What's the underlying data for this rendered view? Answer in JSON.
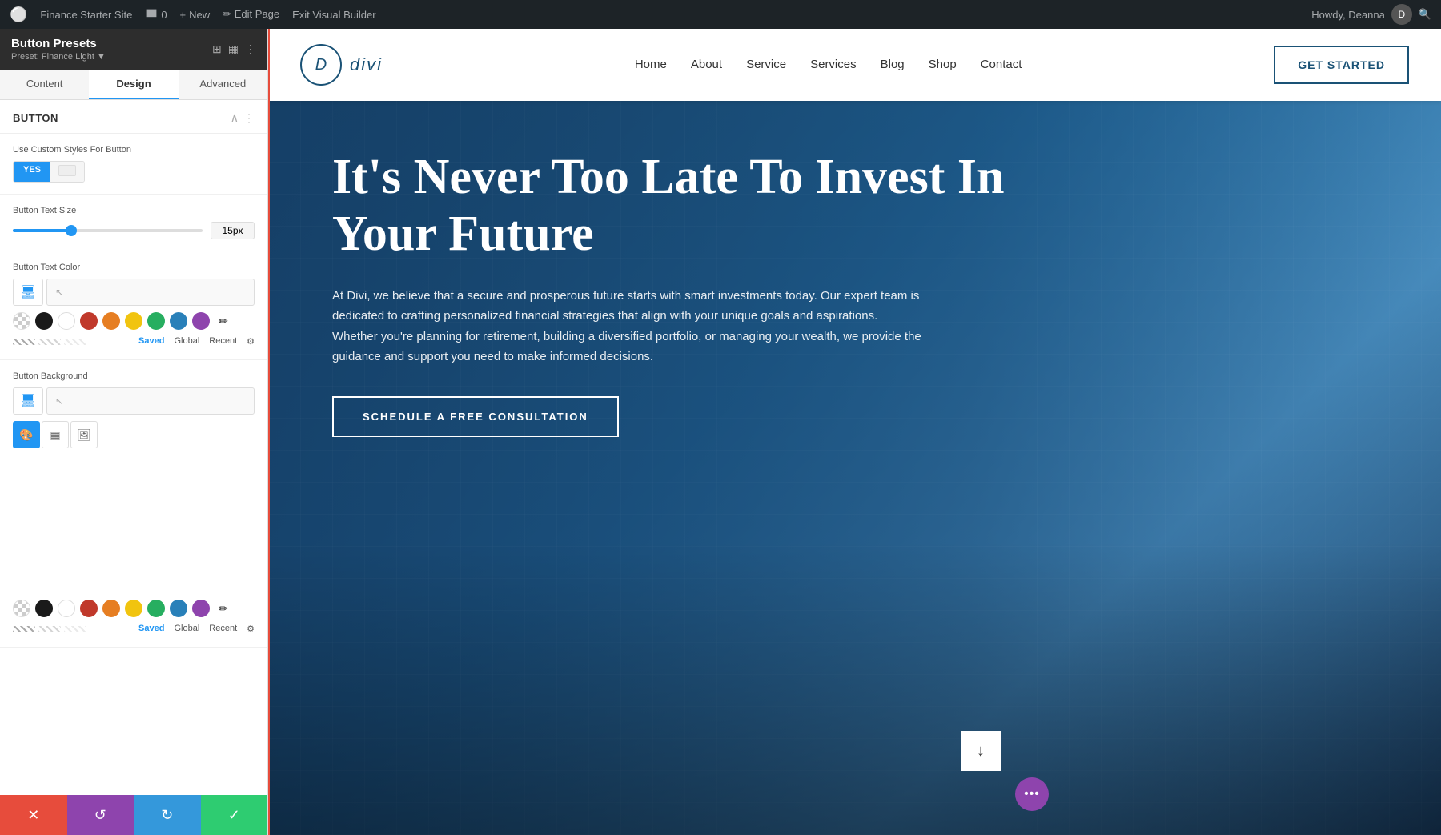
{
  "admin_bar": {
    "wp_logo": "W",
    "site_name": "Finance Starter Site",
    "comments_label": "0",
    "new_label": "New",
    "edit_page_label": "Edit Page",
    "exit_vb_label": "Exit Visual Builder",
    "howdy_label": "Howdy, Deanna"
  },
  "left_panel": {
    "title": "Button Presets",
    "subtitle": "Preset: Finance Light ▼",
    "tabs": [
      "Content",
      "Design",
      "Advanced"
    ],
    "active_tab": "Design",
    "section_title": "Button",
    "use_custom_label": "Use Custom Styles For Button",
    "toggle_yes": "YES",
    "toggle_no": "",
    "button_text_size_label": "Button Text Size",
    "slider_value": "15px",
    "button_text_color_label": "Button Text Color",
    "button_bg_label": "Button Background",
    "saved_label": "Saved",
    "global_label": "Global",
    "recent_label": "Recent",
    "colors": {
      "swatches": [
        "transparent",
        "#1a1a1a",
        "#ffffff",
        "#c0392b",
        "#e67e22",
        "#f1c40f",
        "#27ae60",
        "#2980b9",
        "#8e44ad"
      ],
      "pencil": "✏"
    }
  },
  "site_nav": {
    "logo_letter": "D",
    "logo_text": "divi",
    "menu_items": [
      "Home",
      "About",
      "Service",
      "Services",
      "Blog",
      "Shop",
      "Contact"
    ],
    "cta_button": "GET STARTED"
  },
  "hero": {
    "title": "It's Never Too Late To Invest In Your Future",
    "description": "At Divi, we believe that a secure and prosperous future starts with smart investments today. Our expert team is dedicated to crafting personalized financial strategies that align with your unique goals and aspirations. Whether you're planning for retirement, building a diversified portfolio, or managing your wealth, we provide the guidance and support you need to make informed decisions.",
    "cta_label": "SCHEDULE A FREE CONSULTATION"
  },
  "actions": {
    "close_icon": "✕",
    "undo_icon": "↺",
    "redo_icon": "↻",
    "save_icon": "✓"
  }
}
